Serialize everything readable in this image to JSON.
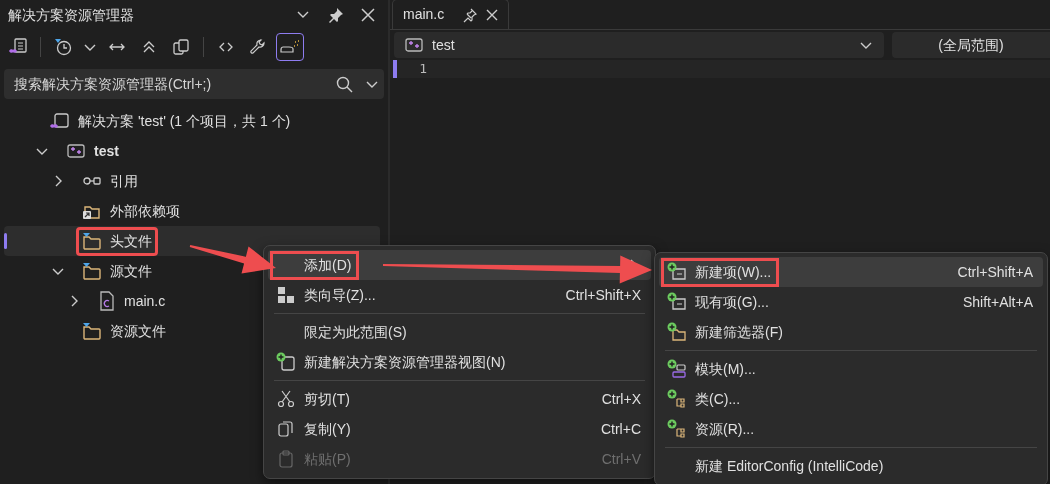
{
  "panel": {
    "title": "解决方案资源管理器",
    "toolbar": [
      {
        "kind": "switch-views",
        "selected": false
      },
      {
        "kind": "separator"
      },
      {
        "kind": "pending",
        "selected": false
      },
      {
        "kind": "dropdown",
        "selected": false
      },
      {
        "kind": "sync",
        "selected": false
      },
      {
        "kind": "collapse",
        "selected": false
      },
      {
        "kind": "show-all",
        "selected": false
      },
      {
        "kind": "separator"
      },
      {
        "kind": "code",
        "selected": false
      },
      {
        "kind": "properties",
        "selected": false
      },
      {
        "kind": "preview",
        "selected": true
      }
    ],
    "search": {
      "placeholder": "搜索解决方案资源管理器(Ctrl+;)"
    },
    "tree": [
      {
        "label": "解决方案 'test' (1 个项目，共 1 个)",
        "kind": "solution",
        "selected": false,
        "highlighted": false,
        "children": [
          {
            "label": "test",
            "kind": "project",
            "expanded": true,
            "selected": false,
            "highlighted": false,
            "children": [
              {
                "label": "引用",
                "kind": "references",
                "expanded": false,
                "selected": false,
                "highlighted": false
              },
              {
                "label": "外部依赖项",
                "kind": "external",
                "selected": false,
                "highlighted": false
              },
              {
                "label": "头文件",
                "kind": "filter",
                "selected": true,
                "highlighted": true
              },
              {
                "label": "源文件",
                "kind": "filter",
                "expanded": true,
                "selected": false,
                "highlighted": false,
                "children": [
                  {
                    "label": "main.c",
                    "kind": "c-file",
                    "expanded": false,
                    "selected": false,
                    "highlighted": false
                  }
                ]
              },
              {
                "label": "资源文件",
                "kind": "filter",
                "selected": false,
                "highlighted": false
              }
            ]
          }
        ]
      }
    ]
  },
  "editor": {
    "tabs": [
      {
        "label": "main.c",
        "selected": true
      }
    ],
    "nav": {
      "project": "test",
      "scope": "(全局范围)"
    },
    "line_numbers": [
      "1"
    ]
  },
  "context_menu": {
    "items": [
      {
        "kind": "item",
        "label": "添加(D)",
        "submenu": true,
        "selected": true,
        "disabled": false,
        "highlighted": true
      },
      {
        "kind": "item",
        "label": "类向导(Z)...",
        "shortcut": "Ctrl+Shift+X",
        "selected": false,
        "disabled": false,
        "highlighted": false
      },
      {
        "kind": "separator"
      },
      {
        "kind": "item",
        "label": "限定为此范围(S)",
        "selected": false,
        "disabled": false,
        "highlighted": false
      },
      {
        "kind": "item",
        "label": "新建解决方案资源管理器视图(N)",
        "selected": false,
        "disabled": false,
        "highlighted": false
      },
      {
        "kind": "separator"
      },
      {
        "kind": "item",
        "label": "剪切(T)",
        "shortcut": "Ctrl+X",
        "selected": false,
        "disabled": false,
        "highlighted": false
      },
      {
        "kind": "item",
        "label": "复制(Y)",
        "shortcut": "Ctrl+C",
        "selected": false,
        "disabled": false,
        "highlighted": false
      },
      {
        "kind": "item",
        "label": "粘贴(P)",
        "shortcut": "Ctrl+V",
        "selected": false,
        "disabled": true,
        "highlighted": false
      }
    ]
  },
  "submenu": {
    "items": [
      {
        "kind": "item",
        "label": "新建项(W)...",
        "shortcut": "Ctrl+Shift+A",
        "selected": true,
        "disabled": false,
        "highlighted": true
      },
      {
        "kind": "item",
        "label": "现有项(G)...",
        "shortcut": "Shift+Alt+A",
        "selected": false,
        "disabled": false,
        "highlighted": false
      },
      {
        "kind": "item",
        "label": "新建筛选器(F)",
        "selected": false,
        "disabled": false,
        "highlighted": false
      },
      {
        "kind": "separator"
      },
      {
        "kind": "item",
        "label": "模块(M)...",
        "selected": false,
        "disabled": false,
        "highlighted": false
      },
      {
        "kind": "item",
        "label": "类(C)...",
        "selected": false,
        "disabled": false,
        "highlighted": false
      },
      {
        "kind": "item",
        "label": "资源(R)...",
        "selected": false,
        "disabled": false,
        "highlighted": false
      },
      {
        "kind": "separator"
      },
      {
        "kind": "item",
        "label": "新建 EditorConfig (IntelliCode)",
        "selected": false,
        "disabled": false,
        "highlighted": false
      }
    ]
  }
}
